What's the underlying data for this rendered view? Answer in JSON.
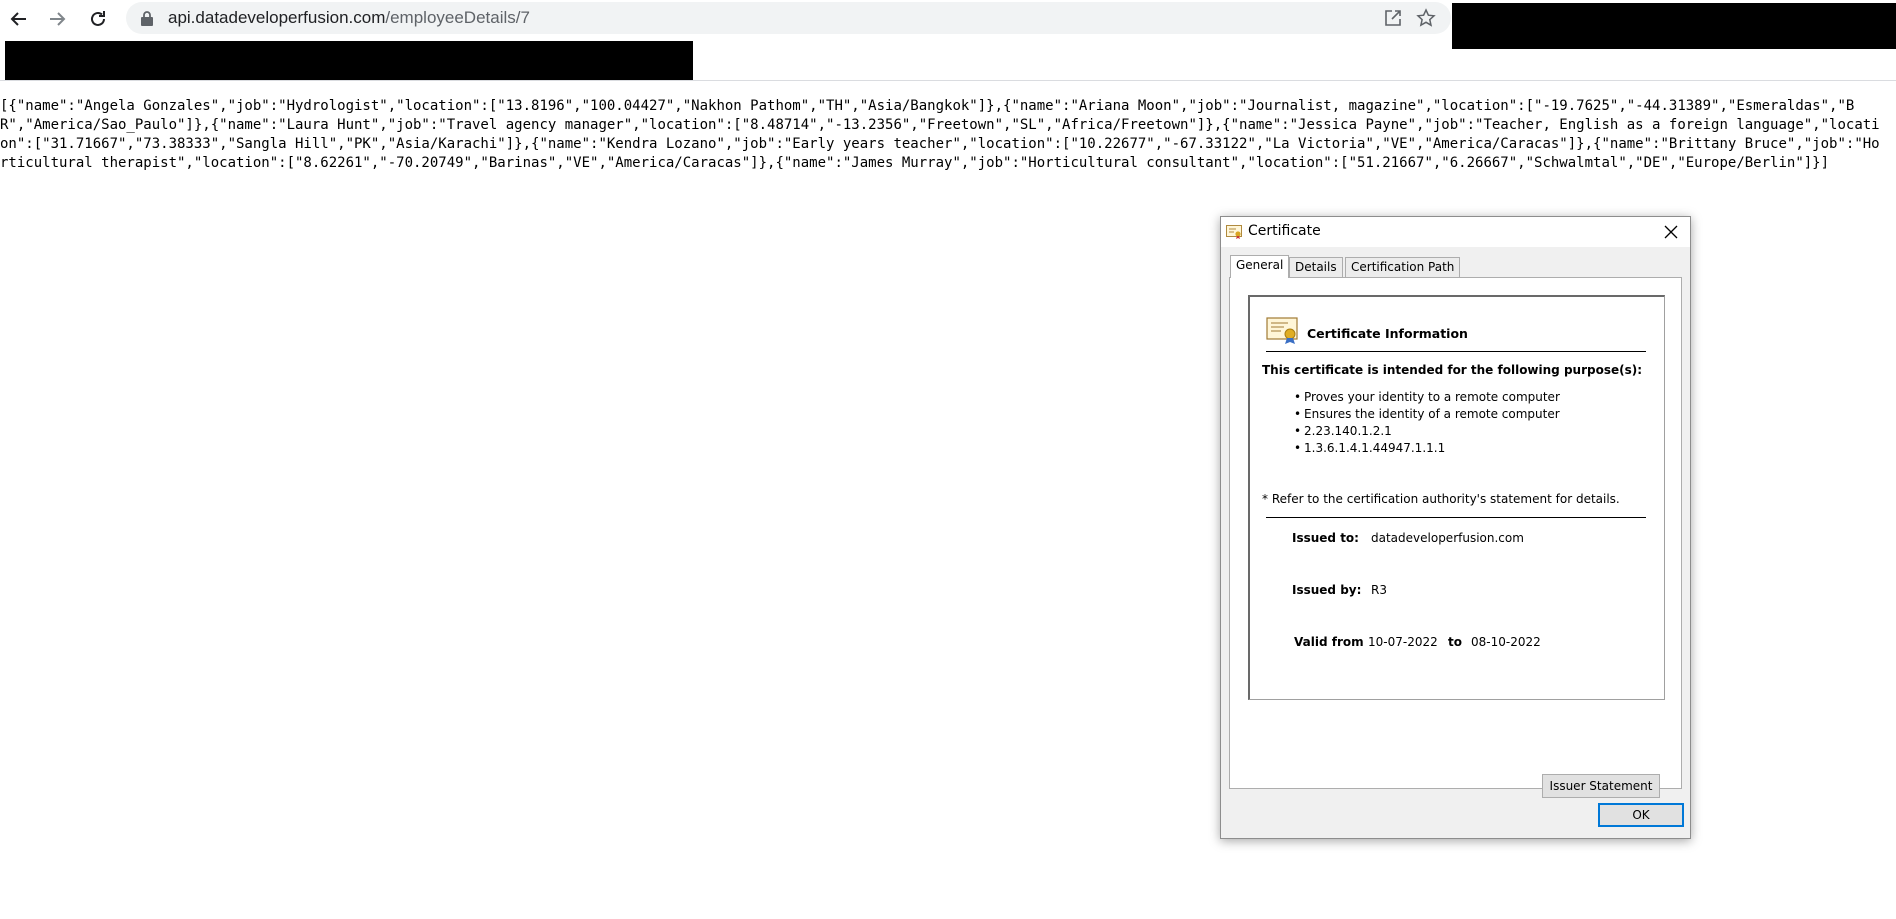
{
  "browser": {
    "url_host": "api.datadeveloperfusion.com",
    "url_path": "/employeeDetails/7"
  },
  "page": {
    "json_text": "[{\"name\":\"Angela Gonzales\",\"job\":\"Hydrologist\",\"location\":[\"13.8196\",\"100.04427\",\"Nakhon Pathom\",\"TH\",\"Asia/Bangkok\"]},{\"name\":\"Ariana Moon\",\"job\":\"Journalist, magazine\",\"location\":[\"-19.7625\",\"-44.31389\",\"Esmeraldas\",\"BR\",\"America/Sao_Paulo\"]},{\"name\":\"Laura Hunt\",\"job\":\"Travel agency manager\",\"location\":[\"8.48714\",\"-13.2356\",\"Freetown\",\"SL\",\"Africa/Freetown\"]},{\"name\":\"Jessica Payne\",\"job\":\"Teacher, English as a foreign language\",\"location\":[\"31.71667\",\"73.38333\",\"Sangla Hill\",\"PK\",\"Asia/Karachi\"]},{\"name\":\"Kendra Lozano\",\"job\":\"Early years teacher\",\"location\":[\"10.22677\",\"-67.33122\",\"La Victoria\",\"VE\",\"America/Caracas\"]},{\"name\":\"Brittany Bruce\",\"job\":\"Horticultural therapist\",\"location\":[\"8.62261\",\"-70.20749\",\"Barinas\",\"VE\",\"America/Caracas\"]},{\"name\":\"James Murray\",\"job\":\"Horticultural consultant\",\"location\":[\"51.21667\",\"6.26667\",\"Schwalmtal\",\"DE\",\"Europe/Berlin\"]}]"
  },
  "dialog": {
    "title": "Certificate",
    "tabs": [
      "General",
      "Details",
      "Certification Path"
    ],
    "info_heading": "Certificate Information",
    "purpose_heading": "This certificate is intended for the following purpose(s):",
    "purposes": [
      "Proves your identity to a remote computer",
      "Ensures the identity of a remote computer",
      "2.23.140.1.2.1",
      "1.3.6.1.4.1.44947.1.1.1"
    ],
    "refer_note": "* Refer to the certification authority's statement for details.",
    "issued_to_label": "Issued to:",
    "issued_to_value": "datadeveloperfusion.com",
    "issued_by_label": "Issued by:",
    "issued_by_value": "R3",
    "valid_from_label": "Valid from",
    "valid_from_value": "10-07-2022",
    "valid_to_label": "to",
    "valid_to_value": "08-10-2022",
    "issuer_statement_button": "Issuer Statement",
    "ok_button": "OK"
  },
  "colors": {
    "omnibox_bg": "#f1f3f4",
    "dialog_bg": "#f0f0f0",
    "ok_border": "#0078d7"
  },
  "icons": [
    "back-arrow-icon",
    "forward-arrow-icon",
    "reload-icon",
    "lock-icon",
    "share-icon",
    "star-icon",
    "certificate-icon",
    "close-icon"
  ]
}
